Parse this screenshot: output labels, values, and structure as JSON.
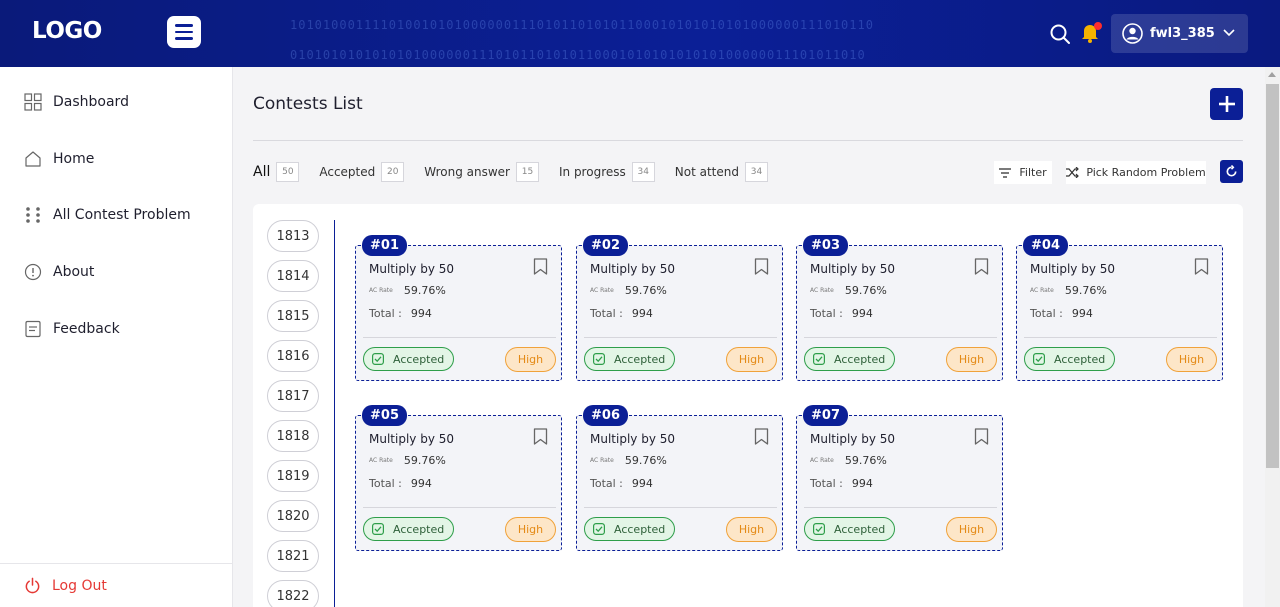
{
  "header": {
    "logo": "LOGO",
    "username": "fwl3_385",
    "binary_line1": "10101000111101001010100000011101011010101100010101010101000000111010110",
    "binary_line2": "0101010101010101000000111010110101011000101010101010100000011101011010"
  },
  "sidebar": {
    "items": [
      {
        "label": "Dashboard",
        "icon": "grid-icon"
      },
      {
        "label": "Home",
        "icon": "home-icon"
      },
      {
        "label": "All Contest Problem",
        "icon": "dots-icon"
      },
      {
        "label": "About",
        "icon": "info-icon"
      },
      {
        "label": "Feedback",
        "icon": "feedback-icon"
      }
    ],
    "logout": "Log Out"
  },
  "main": {
    "title": "Contests List",
    "tabs": [
      {
        "label": "All",
        "count": "50"
      },
      {
        "label": "Accepted",
        "count": "20"
      },
      {
        "label": "Wrong answer",
        "count": "15"
      },
      {
        "label": "In progress",
        "count": "34"
      },
      {
        "label": "Not attend",
        "count": "34"
      }
    ],
    "filter_label": "Filter",
    "random_label": "Pick Random Problem",
    "contests": [
      "1813",
      "1814",
      "1815",
      "1816",
      "1817",
      "1818",
      "1819",
      "1820",
      "1821",
      "1822"
    ],
    "cards": [
      {
        "badge": "#01",
        "title": "Multiply by 50",
        "rate_label": "AC Rate",
        "rate": "59.76%",
        "total_label": "Total :",
        "total": "994",
        "status": "Accepted",
        "level": "High"
      },
      {
        "badge": "#02",
        "title": "Multiply by 50",
        "rate_label": "AC Rate",
        "rate": "59.76%",
        "total_label": "Total :",
        "total": "994",
        "status": "Accepted",
        "level": "High"
      },
      {
        "badge": "#03",
        "title": "Multiply by 50",
        "rate_label": "AC Rate",
        "rate": "59.76%",
        "total_label": "Total :",
        "total": "994",
        "status": "Accepted",
        "level": "High"
      },
      {
        "badge": "#04",
        "title": "Multiply by 50",
        "rate_label": "AC Rate",
        "rate": "59.76%",
        "total_label": "Total :",
        "total": "994",
        "status": "Accepted",
        "level": "High"
      },
      {
        "badge": "#05",
        "title": "Multiply by 50",
        "rate_label": "AC Rate",
        "rate": "59.76%",
        "total_label": "Total :",
        "total": "994",
        "status": "Accepted",
        "level": "High"
      },
      {
        "badge": "#06",
        "title": "Multiply by 50",
        "rate_label": "AC Rate",
        "rate": "59.76%",
        "total_label": "Total :",
        "total": "994",
        "status": "Accepted",
        "level": "High"
      },
      {
        "badge": "#07",
        "title": "Multiply by 50",
        "rate_label": "AC Rate",
        "rate": "59.76%",
        "total_label": "Total :",
        "total": "994",
        "status": "Accepted",
        "level": "High"
      }
    ]
  },
  "colors": {
    "brand": "#0b1f96",
    "accepted": "#2e9e4a",
    "high": "#f0a23a",
    "logout": "#e53935",
    "notification": "#ff2d2d"
  }
}
